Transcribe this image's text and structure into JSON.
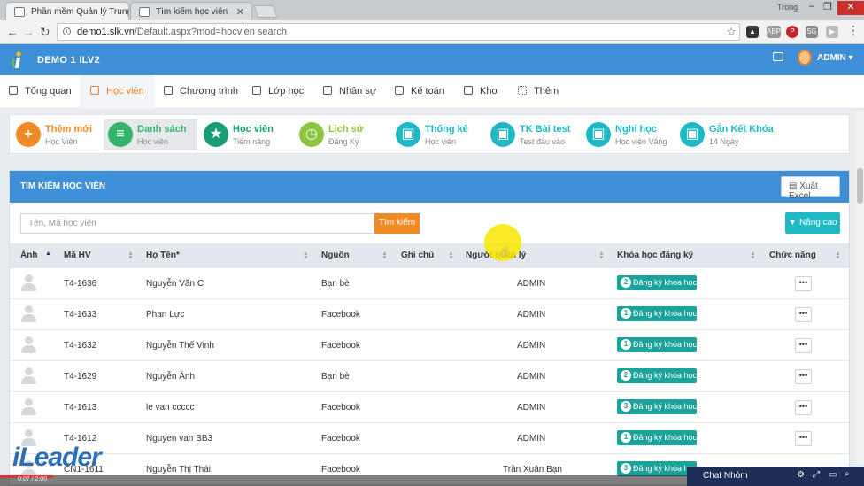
{
  "browser": {
    "tabs": [
      {
        "title": "Phần mềm Quản lý Trung tâm"
      },
      {
        "title": "Tìm kiếm học viên"
      }
    ],
    "window_label": "Trong",
    "url_domain": "demo1.slk.vn",
    "url_path": "/Default.aspx?mod=hocvien search",
    "extensions": [
      "ABP",
      "P",
      "SG"
    ]
  },
  "app": {
    "title": "DEMO 1 ILV2",
    "user": "ADMIN ▾"
  },
  "menu": [
    {
      "label": "Tổng quan",
      "icon": "home-icon"
    },
    {
      "label": "Học viên",
      "icon": "student-icon",
      "active": true
    },
    {
      "label": "Chương trình",
      "icon": "program-icon"
    },
    {
      "label": "Lớp học",
      "icon": "class-icon"
    },
    {
      "label": "Nhân sự",
      "icon": "staff-icon"
    },
    {
      "label": "Kế toán",
      "icon": "accounting-icon"
    },
    {
      "label": "Kho",
      "icon": "warehouse-icon"
    },
    {
      "label": "Thêm",
      "icon": "grid-icon"
    }
  ],
  "shortcuts": [
    {
      "title": "Thêm mới",
      "sub": "Học Viên",
      "color": "#f08a24",
      "glyph": "+"
    },
    {
      "title": "Danh sách",
      "sub": "Học viên",
      "color": "#33b36b",
      "glyph": "≡",
      "active": true
    },
    {
      "title": "Học viên",
      "sub": "Tiềm năng",
      "color": "#1a9e77",
      "glyph": "★"
    },
    {
      "title": "Lịch sử",
      "sub": "Đăng Ký",
      "color": "#8cc63f",
      "glyph": "◷"
    },
    {
      "title": "Thống kê",
      "sub": "Học viên",
      "color": "#1fb9c6",
      "glyph": "▣"
    },
    {
      "title": "TK Bài test",
      "sub": "Test đầu vào",
      "color": "#1fb9c6",
      "glyph": "▣"
    },
    {
      "title": "Nghỉ học",
      "sub": "Học viên Vắng",
      "color": "#1fb9c6",
      "glyph": "▣"
    },
    {
      "title": "Gắn Kết Khóa",
      "sub": "14 Ngày",
      "color": "#1fb9c6",
      "glyph": "▣"
    }
  ],
  "panel": {
    "title": "TÌM KIẾM HỌC VIÊN",
    "export_label": "Xuất Excel",
    "search_placeholder": "Tên, Mã học viên",
    "search_button": "Tìm kiếm",
    "advanced_button": "Nâng cao"
  },
  "table": {
    "columns": [
      "Ảnh",
      "Mã HV",
      "Họ Tên*",
      "Nguồn",
      "Ghi chú",
      "Người quản lý",
      "Khóa học đăng ký",
      "Chức năng"
    ],
    "rows": [
      {
        "code": "T4-1636",
        "name": "Nguyễn Văn C",
        "source": "Bạn bè",
        "note": "",
        "manager": "ADMIN",
        "count": "2",
        "course": "Đăng ký khóa học"
      },
      {
        "code": "T4-1633",
        "name": "Phan Lực",
        "source": "Facebook",
        "note": "",
        "manager": "ADMIN",
        "count": "1",
        "course": "Đăng ký khóa học"
      },
      {
        "code": "T4-1632",
        "name": "Nguyễn Thế Vinh",
        "source": "Facebook",
        "note": "",
        "manager": "ADMIN",
        "count": "1",
        "course": "Đăng ký khóa học"
      },
      {
        "code": "T4-1629",
        "name": "Nguyễn Ánh",
        "source": "Bạn bè",
        "note": "",
        "manager": "ADMIN",
        "count": "2",
        "course": "Đăng ký khóa học"
      },
      {
        "code": "T4-1613",
        "name": "le van ccccc",
        "source": "Facebook",
        "note": "",
        "manager": "ADMIN",
        "count": "3",
        "course": "Đăng ký khóa học"
      },
      {
        "code": "T4-1612",
        "name": "Nguyen van BB3",
        "source": "Facebook",
        "note": "",
        "manager": "ADMIN",
        "count": "1",
        "course": "Đăng ký khóa học"
      },
      {
        "code": "CN1-1611",
        "name": "Nguyễn Thị Thái",
        "source": "Facebook",
        "note": "",
        "manager": "Trần Xuân Bạn",
        "count": "3",
        "course": "Đăng ký khóa học"
      }
    ]
  },
  "overlay": {
    "watermark": "iLeader",
    "chat_label": "Chat Nhóm",
    "video_time": "0:07 / 2:00"
  }
}
